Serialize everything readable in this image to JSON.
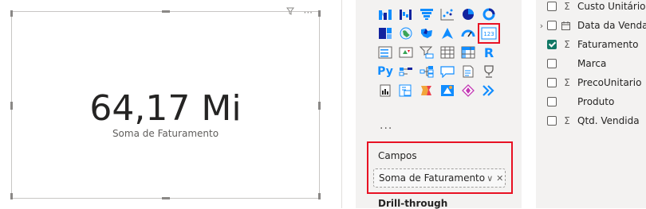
{
  "card": {
    "value": "64,17 Mi",
    "label": "Soma de Faturamento",
    "menu_more": "···"
  },
  "visualizations": {
    "more_label": "...",
    "rows": [
      [
        "ribbon-chart-icon",
        "waterfall-chart-icon",
        "funnel-chart-icon",
        "scatter-chart-icon",
        "pie-chart-icon",
        "donut-chart-icon"
      ],
      [
        "treemap-icon",
        "map-icon",
        "filled-map-icon",
        "azure-map-icon",
        "gauge-icon",
        "card-icon"
      ],
      [
        "multi-row-card-icon",
        "kpi-icon",
        "slicer-icon",
        "table-icon",
        "matrix-icon",
        "r-visual-icon"
      ],
      [
        "python-visual-icon",
        "key-influencers-icon",
        "decomposition-tree-icon",
        "qa-icon",
        "smart-narrative-icon",
        "goals-icon"
      ],
      [
        "paginated-report-icon",
        "power-apps-icon",
        "power-automate-icon",
        "arcgis-icon",
        "diamond-visual-icon",
        "chevron-visual-icon"
      ]
    ],
    "selected": "card-icon",
    "card_icon_text": "123",
    "r_text": "R",
    "py_text": "Py"
  },
  "fields_well": {
    "title": "Campos",
    "pill_label": "Soma de Faturamento"
  },
  "drillthrough": {
    "title": "Drill-through"
  },
  "fields": [
    {
      "name": "Custo Unitário",
      "expandable": false,
      "checked": false,
      "icon": "sigma"
    },
    {
      "name": "Data da Venda",
      "expandable": true,
      "checked": false,
      "icon": "calendar"
    },
    {
      "name": "Faturamento",
      "expandable": false,
      "checked": true,
      "icon": "sigma"
    },
    {
      "name": "Marca",
      "expandable": false,
      "checked": false,
      "icon": ""
    },
    {
      "name": "PrecoUnitario",
      "expandable": false,
      "checked": false,
      "icon": "sigma"
    },
    {
      "name": "Produto",
      "expandable": false,
      "checked": false,
      "icon": ""
    },
    {
      "name": "Qtd. Vendida",
      "expandable": false,
      "checked": false,
      "icon": "sigma"
    }
  ],
  "glyphs": {
    "sigma": "Σ",
    "chevron": "›",
    "dropdown": "∨",
    "close": "✕"
  },
  "colors": {
    "accent_red": "#e81123",
    "checkbox_green": "#117865",
    "icon_blue": "#118dff",
    "pane_bg": "#f3f2f1"
  }
}
